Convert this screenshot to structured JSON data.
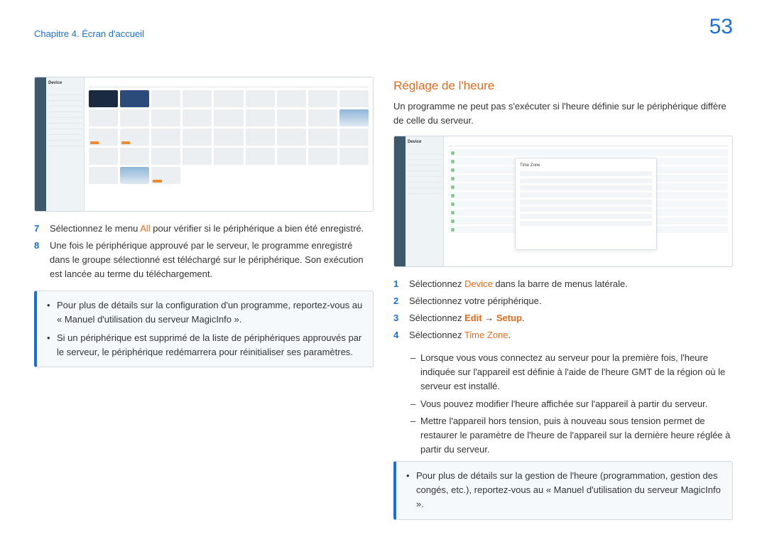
{
  "header": {
    "breadcrumb": "Chapitre 4. Écran d'accueil",
    "page_number": "53"
  },
  "left": {
    "screenshot1": {
      "panel_title": "Device"
    },
    "steps": [
      {
        "n": "7",
        "pre": "Sélectionnez le menu ",
        "accent": "All",
        "post": " pour vérifier si le périphérique a bien été enregistré."
      },
      {
        "n": "8",
        "pre": "Une fois le périphérique approuvé par le serveur, le programme enregistré dans le groupe sélectionné est téléchargé sur le périphérique. Son exécution est lancée au terme du téléchargement.",
        "accent": "",
        "post": ""
      }
    ],
    "note": [
      "Pour plus de détails sur la configuration d'un programme, reportez-vous au « Manuel d'utilisation du serveur MagicInfo ».",
      "Si un périphérique est supprimé de la liste de périphériques approuvés par le serveur, le périphérique redémarrera pour réinitialiser ses paramètres."
    ]
  },
  "right": {
    "title": "Réglage de l'heure",
    "intro": "Un programme ne peut pas s'exécuter si l'heure définie sur le périphérique diffère de celle du serveur.",
    "screenshot2": {
      "panel_title": "Device",
      "form_title": "Time Zone"
    },
    "steps": [
      {
        "n": "1",
        "pre": "Sélectionnez ",
        "accent": "Device",
        "post": " dans la barre de menus latérale."
      },
      {
        "n": "2",
        "pre": "Sélectionnez votre périphérique.",
        "accent": "",
        "post": ""
      },
      {
        "n": "3",
        "pre": "Sélectionnez ",
        "accent": "Edit",
        "mid": " → ",
        "accent2": "Setup",
        "post": "."
      },
      {
        "n": "4",
        "pre": "Sélectionnez ",
        "accent": "Time Zone",
        "post": "."
      }
    ],
    "sub": [
      "Lorsque vous vous connectez au serveur pour la première fois, l'heure indiquée sur l'appareil est définie à l'aide de l'heure GMT de la région où le serveur est installé.",
      "Vous pouvez modifier l'heure affichée sur l'appareil à partir du serveur.",
      "Mettre l'appareil hors tension, puis à nouveau sous tension permet de restaurer le paramètre de l'heure de l'appareil sur la dernière heure réglée à partir du serveur."
    ],
    "note": [
      "Pour plus de détails sur la gestion de l'heure (programmation, gestion des congés, etc.), reportez-vous au « Manuel d'utilisation du serveur MagicInfo »."
    ]
  }
}
